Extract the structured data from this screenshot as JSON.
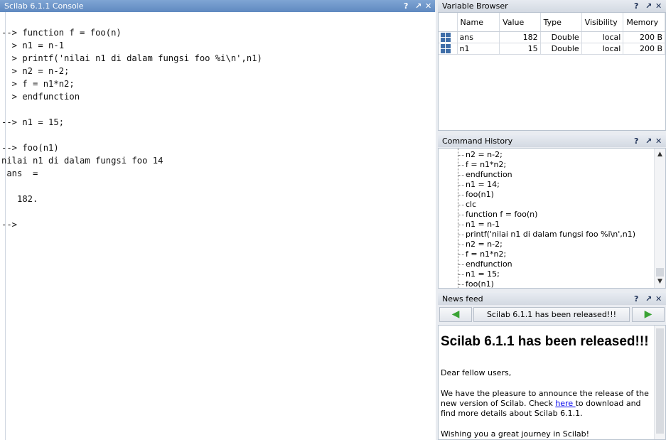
{
  "console": {
    "title": "Scilab 6.1.1 Console",
    "controls": [
      "?",
      "↗",
      "✕"
    ],
    "lines": [
      "--> function f = foo(n)",
      "  > n1 = n-1",
      "  > printf('nilai n1 di dalam fungsi foo %i\\n',n1)",
      "  > n2 = n-2;",
      "  > f = n1*n2;",
      "  > endfunction",
      "--> n1 = 15;",
      "--> foo(n1)",
      "nilai n1 di dalam fungsi foo 14",
      " ans  =",
      "   182.",
      "-->"
    ]
  },
  "variable_browser": {
    "title": "Variable Browser",
    "controls": [
      "?",
      "↗",
      "✕"
    ],
    "columns": [
      "Name",
      "Value",
      "Type",
      "Visibility",
      "Memory"
    ],
    "rows": [
      {
        "name": "ans",
        "value": "182",
        "type": "Double",
        "visibility": "local",
        "memory": "200 B"
      },
      {
        "name": "n1",
        "value": "15",
        "type": "Double",
        "visibility": "local",
        "memory": "200 B"
      }
    ]
  },
  "command_history": {
    "title": "Command History",
    "controls": [
      "?",
      "↗",
      "✕"
    ],
    "items": [
      "n2 = n-2;",
      "f = n1*n2;",
      "endfunction",
      "n1 = 14;",
      "foo(n1)",
      "clc",
      "function f = foo(n)",
      "n1 = n-1",
      "printf('nilai n1 di dalam fungsi foo %i\\n',n1)",
      "n2 = n-2;",
      "f = n1*n2;",
      "endfunction",
      "n1 = 15;",
      "foo(n1)"
    ]
  },
  "news_feed": {
    "title": "News feed",
    "controls": [
      "?",
      "↗",
      "✕"
    ],
    "headline_button": "Scilab 6.1.1 has been released!!!",
    "heading": "Scilab 6.1.1 has been released!!!",
    "greeting": "Dear fellow users,",
    "body_before_link": "We have the pleasure to announce the release of the new version of Scilab. Check ",
    "link_text": "here ",
    "body_after_link": "to download and find more details about Scilab 6.1.1.",
    "closing": "Wishing you a great journey in Scilab!"
  }
}
